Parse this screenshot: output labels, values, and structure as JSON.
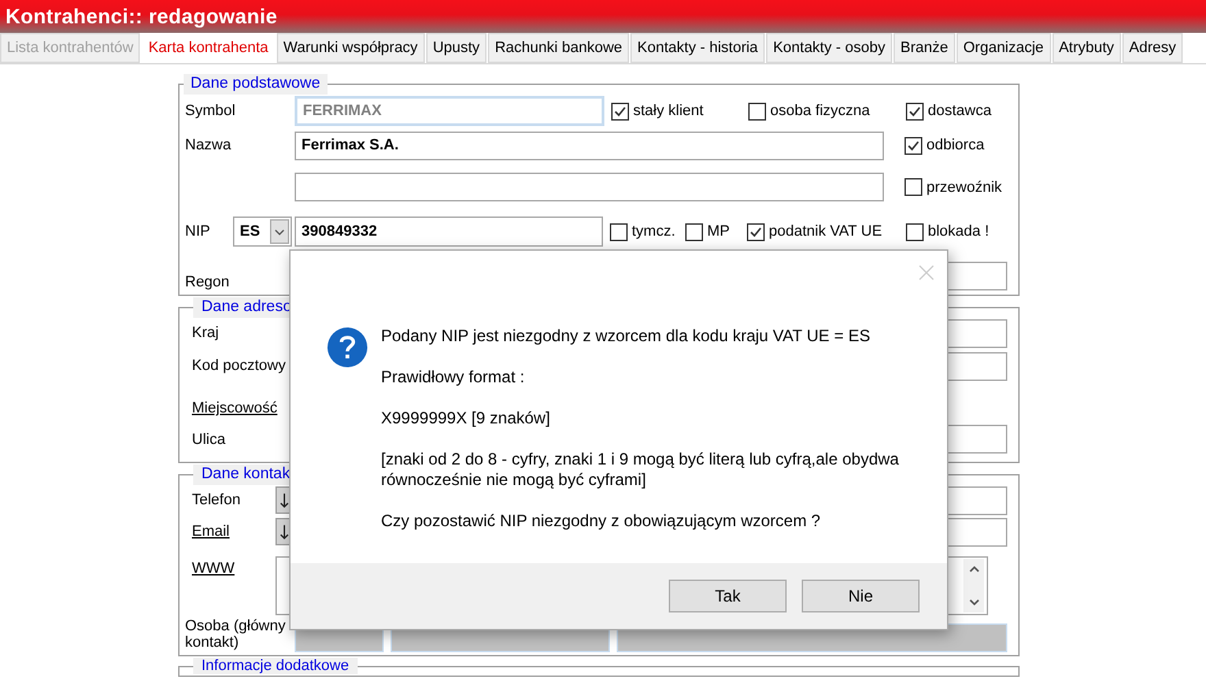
{
  "window": {
    "title": "Kontrahenci:: redagowanie"
  },
  "tabs": [
    {
      "label": "Lista kontrahentów",
      "selected": false,
      "disabled": true
    },
    {
      "label": "Karta kontrahenta",
      "selected": true,
      "disabled": false
    },
    {
      "label": "Warunki współpracy",
      "selected": false,
      "disabled": false
    },
    {
      "label": "Upusty",
      "selected": false,
      "disabled": false
    },
    {
      "label": "Rachunki bankowe",
      "selected": false,
      "disabled": false
    },
    {
      "label": "Kontakty - historia",
      "selected": false,
      "disabled": false
    },
    {
      "label": "Kontakty - osoby",
      "selected": false,
      "disabled": false
    },
    {
      "label": "Branże",
      "selected": false,
      "disabled": false
    },
    {
      "label": "Organizacje",
      "selected": false,
      "disabled": false
    },
    {
      "label": "Atrybuty",
      "selected": false,
      "disabled": false
    },
    {
      "label": "Adresy",
      "selected": false,
      "disabled": false
    }
  ],
  "basic": {
    "legend": "Dane podstawowe",
    "symbol": {
      "label": "Symbol",
      "value": "FERRIMAX"
    },
    "symbol_flags": [
      {
        "label": "stały klient",
        "checked": true
      },
      {
        "label": "osoba fizyczna",
        "checked": false
      }
    ],
    "name": {
      "label": "Nazwa",
      "value": "Ferrimax S.A."
    },
    "roles": [
      {
        "label": "dostawca",
        "checked": true
      },
      {
        "label": "odbiorca",
        "checked": true
      },
      {
        "label": "przewoźnik",
        "checked": false
      }
    ],
    "nip": {
      "label": "NIP",
      "country": "ES",
      "value": "390849332"
    },
    "nip_flags": [
      {
        "label": "tymcz.",
        "checked": false
      },
      {
        "label": "MP",
        "checked": false
      },
      {
        "label": "podatnik VAT UE",
        "checked": true
      }
    ],
    "blocked": {
      "label": "blokada !",
      "checked": false
    },
    "regon": {
      "label": "Regon"
    }
  },
  "address": {
    "legend": "Dane adreso",
    "fields": [
      {
        "label": "Kraj",
        "kind": "input",
        "link": false
      },
      {
        "label": "Kod pocztowy",
        "kind": "input",
        "link": false
      },
      {
        "label": "Miejscowość",
        "kind": "none",
        "link": true
      },
      {
        "label": "Ulica",
        "kind": "input",
        "link": false
      }
    ]
  },
  "contact": {
    "legend": "Dane kontak",
    "fields": [
      {
        "label": "Telefon",
        "kind": "dropdown",
        "link": false
      },
      {
        "label": "Email",
        "kind": "dropdown",
        "link": true
      },
      {
        "label": "WWW",
        "kind": "textarea",
        "link": true
      }
    ],
    "person": {
      "label": "Osoba (główny kontakt)"
    }
  },
  "extra": {
    "legend": "Informacje dodatkowe"
  },
  "dialog": {
    "messages": [
      "Podany NIP jest niezgodny z wzorcem dla kodu kraju VAT UE = ES",
      "Prawidłowy format :",
      "X9999999X [9 znaków]",
      "[znaki od 2 do 8 - cyfry, znaki 1 i 9 mogą być literą lub cyfrą,ale obydwa równocześnie nie mogą być cyframi]",
      "Czy pozostawić NIP niezgodny z obowiązującym wzorcem ?"
    ],
    "buttons": [
      "Tak",
      "Nie"
    ]
  }
}
